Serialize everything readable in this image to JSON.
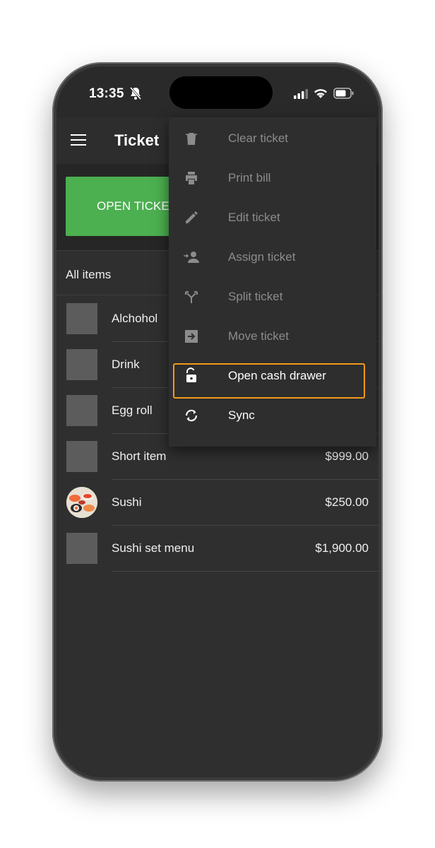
{
  "status": {
    "time": "13:35"
  },
  "appbar": {
    "title": "Ticket"
  },
  "ticket_buttons": {
    "open_tickets_label": "OPEN TICKETS"
  },
  "filter": {
    "label": "All items"
  },
  "items": [
    {
      "name": "Alchohol",
      "price": ""
    },
    {
      "name": "Drink",
      "price": ""
    },
    {
      "name": "Egg roll",
      "price": ""
    },
    {
      "name": "Short item",
      "price": "$999.00"
    },
    {
      "name": "Sushi",
      "price": "$250.00",
      "has_photo": true
    },
    {
      "name": "Sushi set menu",
      "price": "$1,900.00"
    }
  ],
  "menu": {
    "items": [
      {
        "label": "Clear ticket",
        "icon": "trash-icon",
        "enabled": false
      },
      {
        "label": "Print bill",
        "icon": "printer-icon",
        "enabled": false
      },
      {
        "label": "Edit ticket",
        "icon": "pencil-icon",
        "enabled": false
      },
      {
        "label": "Assign ticket",
        "icon": "assign-person-icon",
        "enabled": false
      },
      {
        "label": "Split ticket",
        "icon": "split-icon",
        "enabled": false
      },
      {
        "label": "Move ticket",
        "icon": "move-ticket-icon",
        "enabled": false
      },
      {
        "label": "Open cash drawer",
        "icon": "unlock-icon",
        "enabled": true
      },
      {
        "label": "Sync",
        "icon": "sync-icon",
        "enabled": true
      }
    ],
    "highlighted": "Open cash drawer"
  },
  "colors": {
    "background": "#2f2f2f",
    "accent_green": "#4caf50",
    "highlight_orange": "#f19a1a",
    "disabled_text": "#8c8c8c"
  }
}
